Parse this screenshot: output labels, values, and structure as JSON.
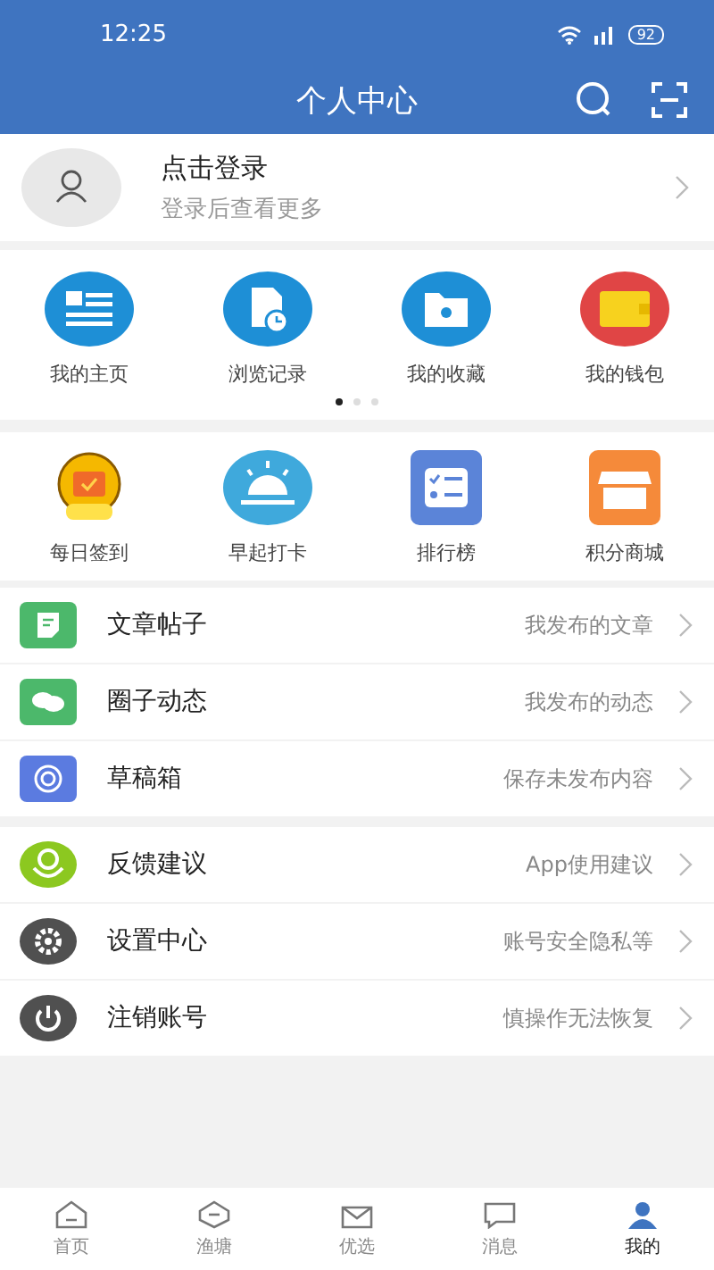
{
  "status_bar": {
    "time": "12:25",
    "battery": "92"
  },
  "header": {
    "title": "个人中心"
  },
  "login": {
    "title": "点击登录",
    "subtitle": "登录后查看更多"
  },
  "shortcuts": [
    {
      "label": "我的主页",
      "color": "#1e8fd6"
    },
    {
      "label": "浏览记录",
      "color": "#1e8fd6"
    },
    {
      "label": "我的收藏",
      "color": "#1e8fd6"
    },
    {
      "label": "我的钱包",
      "color": "#e04545"
    }
  ],
  "page_dots": [
    {
      "selected": true
    },
    {
      "selected": false
    },
    {
      "selected": false
    }
  ],
  "features": [
    {
      "label": "每日签到",
      "color": "#f5b800"
    },
    {
      "label": "早起打卡",
      "color": "#3fa9dc"
    },
    {
      "label": "排行榜",
      "color": "#5b84d8"
    },
    {
      "label": "积分商城",
      "color": "#f58a3a"
    }
  ],
  "menu_groups": [
    [
      {
        "title": "文章帖子",
        "hint": "我发布的文章",
        "color": "#4cb86b"
      },
      {
        "title": "圈子动态",
        "hint": "我发布的动态",
        "color": "#4cb86b"
      },
      {
        "title": "草稿箱",
        "hint": "保存未发布内容",
        "color": "#5b7be0"
      }
    ],
    [
      {
        "title": "反馈建议",
        "hint": "App使用建议",
        "color": "#8cc820"
      },
      {
        "title": "设置中心",
        "hint": "账号安全隐私等",
        "color": "#505050"
      },
      {
        "title": "注销账号",
        "hint": "慎操作无法恢复",
        "color": "#505050"
      }
    ]
  ],
  "tab_bar": [
    {
      "label": "首页",
      "selected": false
    },
    {
      "label": "渔塘",
      "selected": false
    },
    {
      "label": "优选",
      "selected": false
    },
    {
      "label": "消息",
      "selected": false
    },
    {
      "label": "我的",
      "selected": true
    }
  ]
}
